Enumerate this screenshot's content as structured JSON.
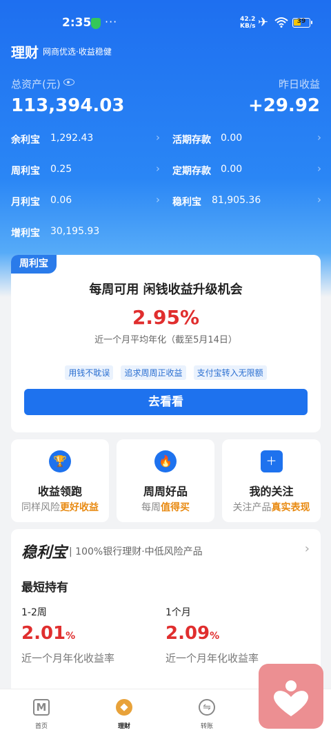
{
  "status_bar": {
    "time": "2:35",
    "dots": "···",
    "speed_top": "42.2",
    "speed_bottom": "KB/s",
    "battery": "39"
  },
  "header": {
    "title": "理财",
    "subtitle": "网商优选·收益稳健"
  },
  "assets": {
    "total_label": "总资产(元)",
    "total_value": "113,394.03",
    "yesterday_label": "昨日收益",
    "yesterday_value": "+29.92"
  },
  "products": [
    {
      "name": "余利宝",
      "value": "1,292.43"
    },
    {
      "name": "活期存款",
      "value": "0.00"
    },
    {
      "name": "周利宝",
      "value": "0.25"
    },
    {
      "name": "定期存款",
      "value": "0.00"
    },
    {
      "name": "月利宝",
      "value": "0.06"
    },
    {
      "name": "稳利宝",
      "value": "81,905.36"
    },
    {
      "name": "增利宝",
      "value": "30,195.93"
    }
  ],
  "promo": {
    "tag": "周利宝",
    "headline": "每周可用 闲钱收益升级机会",
    "rate": "2.95%",
    "rate_desc": "近一个月平均年化（截至5月14日）",
    "chips": [
      "用钱不耽误",
      "追求周周正收益",
      "支付宝转入无限额"
    ],
    "cta": "去看看"
  },
  "features": [
    {
      "title": "收益领跑",
      "sub_plain": "同样风险",
      "sub_highlight": "更好收益",
      "icon": "trophy-icon"
    },
    {
      "title": "周周好品",
      "sub_plain": "每周",
      "sub_highlight": "值得买",
      "icon": "flame-icon"
    },
    {
      "title": "我的关注",
      "sub_plain": "关注产品",
      "sub_highlight": "真实表现",
      "icon": "bookmark-icon"
    }
  ],
  "wenlibao": {
    "logo": "稳利宝",
    "description": "| 100%银行理财·中低风险产品",
    "section": "最短持有",
    "items": [
      {
        "term": "1-2周",
        "rate": "2.01",
        "unit": "%",
        "desc": "近一个月年化收益率"
      },
      {
        "term": "1个月",
        "rate": "2.09",
        "unit": "%",
        "desc": "近一个月年化收益率"
      }
    ]
  },
  "nav": {
    "items": [
      "首页",
      "理财",
      "转账"
    ]
  },
  "colors": {
    "primary": "#1e72ee",
    "rate_red": "#e02e2e",
    "highlight_orange": "#e88a12",
    "float_pink": "#ec8f92"
  }
}
